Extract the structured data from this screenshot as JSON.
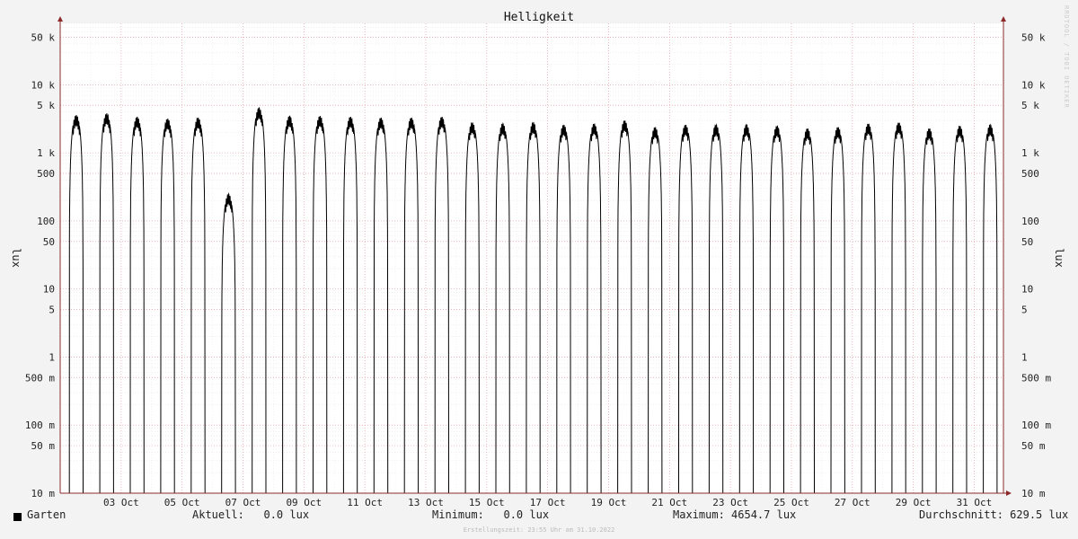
{
  "chart_data": {
    "type": "line",
    "title": "Helligkeit",
    "ylabel": "lux",
    "yscale": "log",
    "ylim": [
      0.01,
      80000
    ],
    "y_ticks": [
      {
        "v": 50000,
        "label": "50 k"
      },
      {
        "v": 10000,
        "label": "10 k"
      },
      {
        "v": 5000,
        "label": "5 k"
      },
      {
        "v": 1000,
        "label": "1 k"
      },
      {
        "v": 500,
        "label": "500"
      },
      {
        "v": 100,
        "label": "100"
      },
      {
        "v": 50,
        "label": "50"
      },
      {
        "v": 10,
        "label": "10"
      },
      {
        "v": 5,
        "label": "5"
      },
      {
        "v": 1,
        "label": "1"
      },
      {
        "v": 0.5,
        "label": "500 m"
      },
      {
        "v": 0.1,
        "label": "100 m"
      },
      {
        "v": 0.05,
        "label": "50 m"
      },
      {
        "v": 0.01,
        "label": "10 m"
      }
    ],
    "x_ticks": [
      "03 Oct",
      "05 Oct",
      "07 Oct",
      "09 Oct",
      "11 Oct",
      "13 Oct",
      "15 Oct",
      "17 Oct",
      "19 Oct",
      "21 Oct",
      "23 Oct",
      "25 Oct",
      "27 Oct",
      "29 Oct",
      "31 Oct"
    ],
    "x_tick_days": [
      3,
      5,
      7,
      9,
      11,
      13,
      15,
      17,
      19,
      21,
      23,
      25,
      27,
      29,
      31
    ],
    "xlim_days": [
      1,
      31.96
    ],
    "grid": true,
    "series": [
      {
        "name": "Garten",
        "color": "#000000",
        "daily_peak_lux": [
          3600,
          3800,
          3400,
          3200,
          3300,
          250,
          4600,
          3500,
          3500,
          3400,
          3300,
          3300,
          3400,
          2800,
          2700,
          2800,
          2600,
          2700,
          3000,
          2400,
          2600,
          2600,
          2600,
          2500,
          2300,
          2400,
          2700,
          2800,
          2300,
          2500,
          2600
        ]
      }
    ]
  },
  "legend": {
    "series_name": "Garten",
    "current": "Aktuell:   0.0 lux",
    "minimum": "Minimum:   0.0 lux",
    "maximum": "Maximum: 4654.7 lux",
    "average": "Durchschnitt: 629.5 lux"
  },
  "footer": "Erstellungszeit: 23:55 Uhr am 31.10.2022",
  "watermark": "RRDTOOL / TOBI OETIKER"
}
